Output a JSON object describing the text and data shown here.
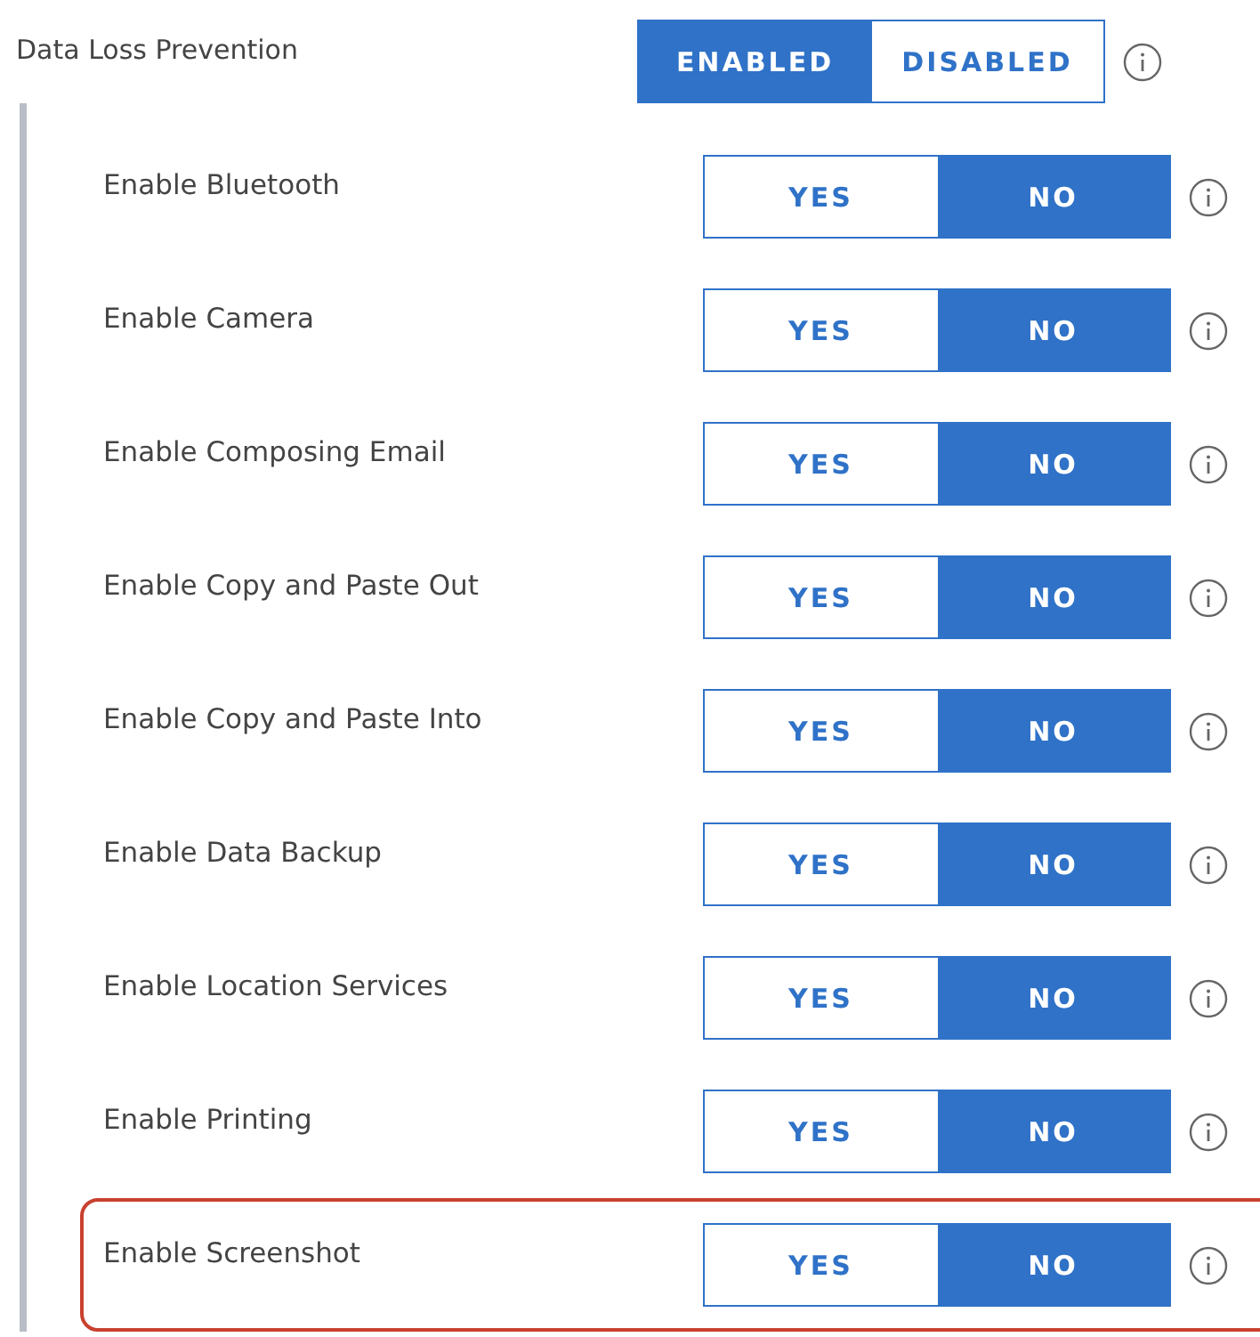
{
  "header": {
    "label": "Data Loss Prevention",
    "options": [
      {
        "label": "ENABLED",
        "selected": true
      },
      {
        "label": "DISABLED",
        "selected": false
      }
    ]
  },
  "settings": [
    {
      "label": "Enable Bluetooth",
      "highlighted": false,
      "options": [
        {
          "label": "YES",
          "selected": false
        },
        {
          "label": "NO",
          "selected": true
        }
      ]
    },
    {
      "label": "Enable Camera",
      "highlighted": false,
      "options": [
        {
          "label": "YES",
          "selected": false
        },
        {
          "label": "NO",
          "selected": true
        }
      ]
    },
    {
      "label": "Enable Composing Email",
      "highlighted": false,
      "options": [
        {
          "label": "YES",
          "selected": false
        },
        {
          "label": "NO",
          "selected": true
        }
      ]
    },
    {
      "label": "Enable Copy and Paste Out",
      "highlighted": false,
      "options": [
        {
          "label": "YES",
          "selected": false
        },
        {
          "label": "NO",
          "selected": true
        }
      ]
    },
    {
      "label": "Enable Copy and Paste Into",
      "highlighted": false,
      "options": [
        {
          "label": "YES",
          "selected": false
        },
        {
          "label": "NO",
          "selected": true
        }
      ]
    },
    {
      "label": "Enable Data Backup",
      "highlighted": false,
      "options": [
        {
          "label": "YES",
          "selected": false
        },
        {
          "label": "NO",
          "selected": true
        }
      ]
    },
    {
      "label": "Enable Location Services",
      "highlighted": false,
      "options": [
        {
          "label": "YES",
          "selected": false
        },
        {
          "label": "NO",
          "selected": true
        }
      ]
    },
    {
      "label": "Enable Printing",
      "highlighted": false,
      "options": [
        {
          "label": "YES",
          "selected": false
        },
        {
          "label": "NO",
          "selected": true
        }
      ]
    },
    {
      "label": "Enable Screenshot",
      "highlighted": true,
      "options": [
        {
          "label": "YES",
          "selected": false
        },
        {
          "label": "NO",
          "selected": true
        }
      ]
    }
  ]
}
